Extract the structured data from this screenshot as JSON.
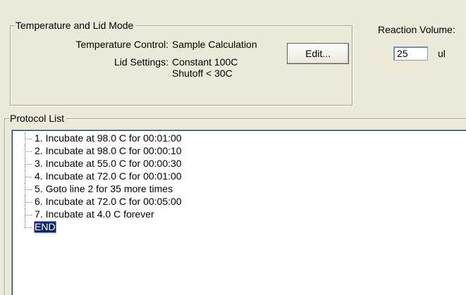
{
  "temperature_group": {
    "title": "Temperature and Lid Mode",
    "temperature_control_label": "Temperature Control:",
    "temperature_control_value": "Sample Calculation",
    "lid_settings_label": "Lid Settings:",
    "lid_settings_line1": "Constant 100C",
    "lid_settings_line2": "Shutoff < 30C",
    "edit_button_label": "Edit..."
  },
  "reaction_volume": {
    "label": "Reaction Volume:",
    "value": "25",
    "unit": "ul"
  },
  "protocol_group": {
    "title": "Protocol List",
    "items": [
      "1. Incubate at 98.0 C for 00:01:00",
      "2. Incubate at 98.0 C for 00:00:10",
      "3. Incubate at 55.0 C for 00:00:30",
      "4. Incubate at 72.0 C for 00:01:00",
      "5. Goto line 2 for 35 more times",
      "6. Incubate at 72.0 C for 00:05:00",
      "7. Incubate at 4.0 C forever",
      "END"
    ],
    "selected_item": "END"
  },
  "colors": {
    "window_background": "#ece9d8",
    "selection_background": "#0a246a",
    "selection_text": "#ffffff"
  }
}
